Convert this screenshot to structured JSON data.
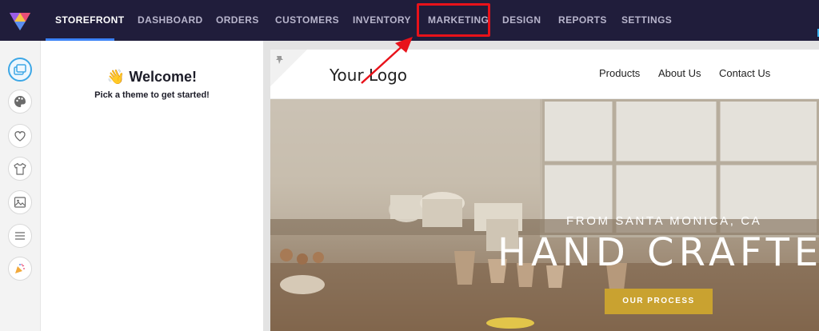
{
  "nav": {
    "items": [
      {
        "label": "STOREFRONT",
        "active": true
      },
      {
        "label": "DASHBOARD",
        "active": false
      },
      {
        "label": "ORDERS",
        "active": false
      },
      {
        "label": "CUSTOMERS",
        "active": false
      },
      {
        "label": "INVENTORY",
        "active": false
      },
      {
        "label": "MARKETING",
        "active": false,
        "highlighted": true
      },
      {
        "label": "DESIGN",
        "active": false
      },
      {
        "label": "REPORTS",
        "active": false
      },
      {
        "label": "SETTINGS",
        "active": false
      }
    ]
  },
  "sidebar": {
    "icons": [
      "pages-icon",
      "palette-icon",
      "heart-icon",
      "tshirt-icon",
      "image-icon",
      "menu-lines-icon",
      "celebration-icon"
    ]
  },
  "welcome": {
    "emoji": "👋",
    "title": "Welcome!",
    "subtitle": "Pick a theme to get started!"
  },
  "preview": {
    "logo_text": "Your Logo",
    "links": [
      "Products",
      "About Us",
      "Contact Us"
    ],
    "hero_subtitle": "FROM SANTA MONICA, CA",
    "hero_title": "HAND CRAFTED",
    "hero_button": "OUR PROCESS"
  },
  "colors": {
    "topbar": "#201d3b",
    "active_underline": "#3b82f6",
    "annotation_red": "#e8121a",
    "hero_button": "#c9a230"
  }
}
